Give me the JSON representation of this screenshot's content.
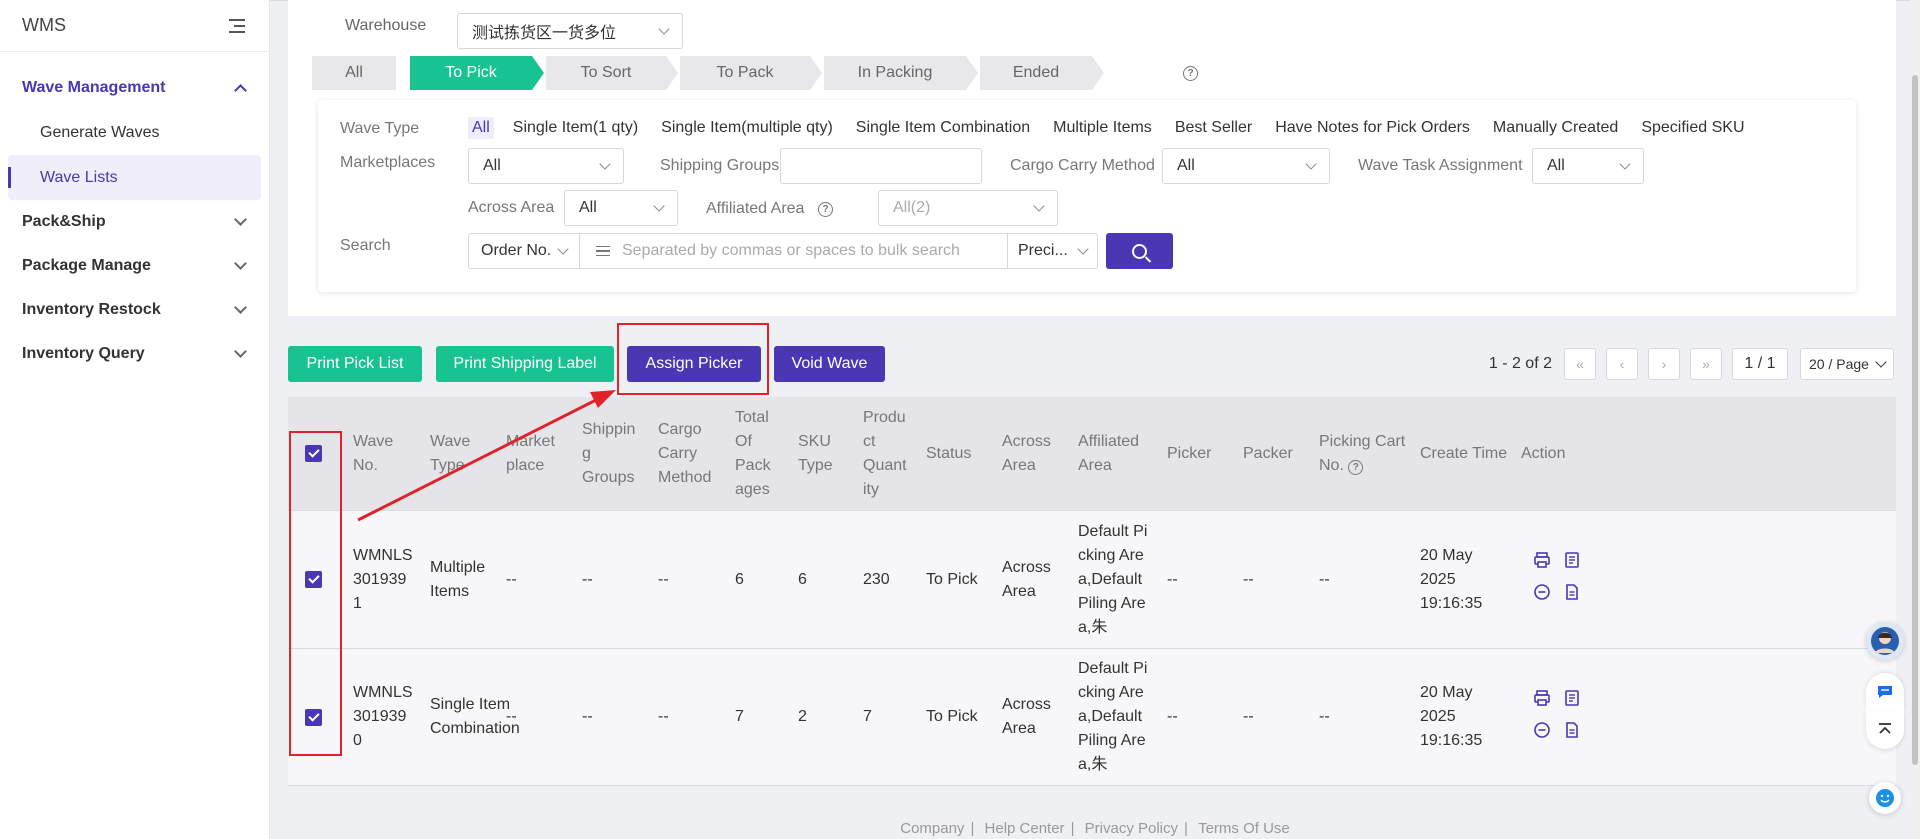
{
  "app": {
    "name": "WMS"
  },
  "sidebar": {
    "groups": [
      {
        "label": "Wave Management",
        "open": true,
        "items": [
          {
            "label": "Generate Waves"
          },
          {
            "label": "Wave Lists",
            "active": true
          }
        ]
      },
      {
        "label": "Pack&Ship"
      },
      {
        "label": "Package Manage"
      },
      {
        "label": "Inventory Restock"
      },
      {
        "label": "Inventory Query"
      }
    ]
  },
  "warehouse": {
    "label": "Warehouse",
    "value": "测试拣货区一货多位"
  },
  "tabs": [
    "All",
    "To Pick",
    "To Sort",
    "To Pack",
    "In Packing",
    "Ended"
  ],
  "active_tab": "To Pick",
  "filters": {
    "wave_type": {
      "label": "Wave Type",
      "options": [
        "All",
        "Single Item(1 qty)",
        "Single Item(multiple qty)",
        "Single Item Combination",
        "Multiple Items",
        "Best Seller",
        "Have Notes for Pick Orders",
        "Manually Created",
        "Specified SKU"
      ],
      "selected": "All"
    },
    "marketplaces": {
      "label": "Marketplaces",
      "value": "All"
    },
    "shipping_groups": {
      "label": "Shipping Groups",
      "value": ""
    },
    "cargo_carry": {
      "label": "Cargo Carry Method",
      "value": "All"
    },
    "wave_task": {
      "label": "Wave Task Assignment",
      "value": "All"
    },
    "across_area": {
      "label": "Across Area",
      "value": "All"
    },
    "affiliated_area": {
      "label": "Affiliated Area",
      "value": "All(2)"
    },
    "search": {
      "label": "Search",
      "field": "Order No.",
      "placeholder": "Separated by commas or spaces to bulk search",
      "mode": "Preci..."
    }
  },
  "toolbar": {
    "print_pick_list": "Print Pick List",
    "print_shipping_label": "Print Shipping Label",
    "assign_picker": "Assign Picker",
    "void_wave": "Void Wave"
  },
  "pager": {
    "count": "1 - 2 of 2",
    "page": "1 / 1",
    "size": "20 / Page"
  },
  "table": {
    "headers": [
      "Wave No.",
      "Wave Type",
      "Market place",
      "Shippin g Groups",
      "Cargo Carry Method",
      "Total Of Pack ages",
      "SKU Type",
      "Produ ct Quant ity",
      "Status",
      "Across Area",
      "Affiliated Area",
      "Picker",
      "Packer",
      "Picking Cart No.",
      "Create Time",
      "Action"
    ],
    "rows": [
      {
        "wave_no": "WMNLS3019391",
        "wave_type": "Multiple Items",
        "marketplace": "--",
        "shipping_groups": "--",
        "cargo_carry": "--",
        "total_packages": "6",
        "sku_type": "6",
        "product_qty": "230",
        "status": "To Pick",
        "across_area": "Across Area",
        "affiliated_area": "Default Picking Area,Default Piling Area,朱",
        "picker": "--",
        "packer": "--",
        "cart_no": "--",
        "create_time": "20 May 2025 19:16:35"
      },
      {
        "wave_no": "WMNLS3019390",
        "wave_type": "Single Item Combination",
        "marketplace": "--",
        "shipping_groups": "--",
        "cargo_carry": "--",
        "total_packages": "7",
        "sku_type": "2",
        "product_qty": "7",
        "status": "To Pick",
        "across_area": "Across Area",
        "affiliated_area": "Default Picking Area,Default Piling Area,朱",
        "picker": "--",
        "packer": "--",
        "cart_no": "--",
        "create_time": "20 May 2025 19:16:35"
      }
    ]
  },
  "footer": [
    "Company",
    "Help Center",
    "Privacy Policy",
    "Terms Of Use"
  ],
  "colors": {
    "primary": "#4b36b3",
    "green": "#19c391",
    "annotation": "#e0232a"
  }
}
